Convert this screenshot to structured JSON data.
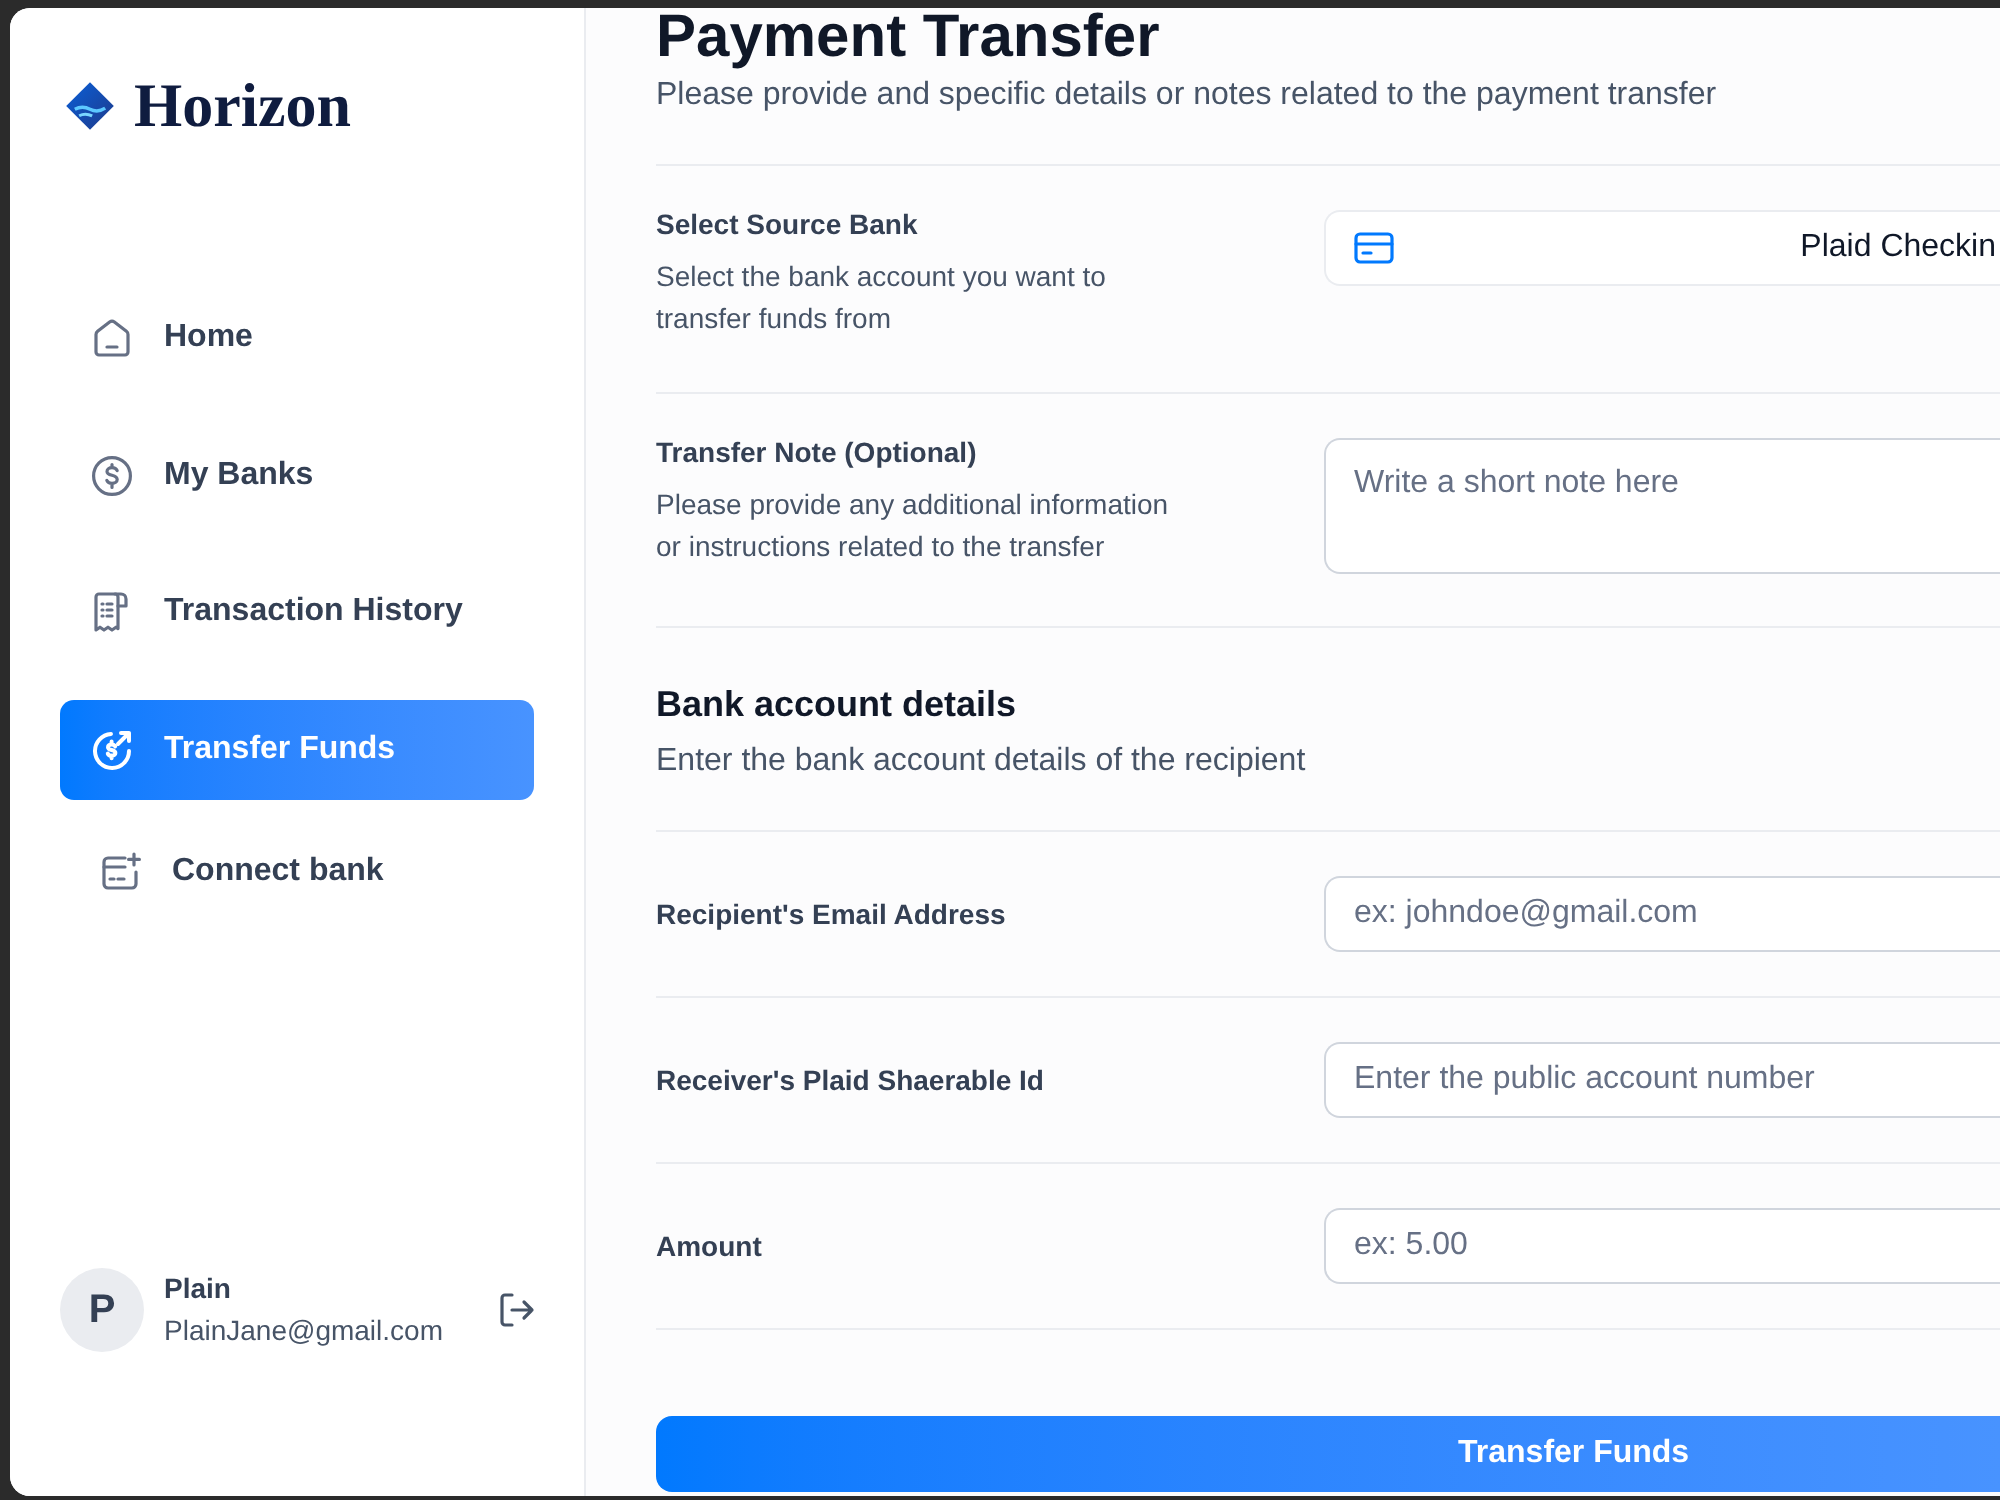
{
  "sidebar": {
    "logo": {
      "name": "Horizon"
    },
    "nav_items": [
      {
        "label": "Home",
        "kind": "nav",
        "selected": false
      },
      {
        "label": "My Banks",
        "kind": "nav",
        "selected": false
      },
      {
        "label": "Transaction History",
        "kind": "nav",
        "selected": false
      },
      {
        "label": "Transfer Funds",
        "kind": "nav",
        "selected": true
      },
      {
        "label": "Connect bank",
        "kind": "action",
        "selected": false
      }
    ],
    "user": {
      "initial": "P",
      "name": "Plain",
      "email": "PlainJane@gmail.com"
    }
  },
  "header": {
    "title": "Payment Transfer",
    "subtitle": "Please provide and specific details or notes related to the payment transfer"
  },
  "transfer_details": [
    {
      "kind": "select",
      "label": "Select Source Bank",
      "description": "Select the bank account you want to transfer funds from",
      "value": "Plaid Checkin"
    },
    {
      "kind": "textarea",
      "label": "Transfer Note (Optional)",
      "description": "Please provide any additional information or instructions related to the transfer",
      "placeholder": "Write a short note here"
    }
  ],
  "bank_account_details": {
    "title": "Bank account details",
    "subtitle": "Enter the bank account details of the recipient",
    "fields": [
      {
        "label": "Recipient's Email Address",
        "placeholder": "ex: johndoe@gmail.com"
      },
      {
        "label": "Receiver's Plaid Shaerable Id",
        "placeholder": "Enter the public account number"
      },
      {
        "label": "Amount",
        "placeholder": "ex: 5.00"
      }
    ]
  },
  "submit_button": {
    "label": "Transfer Funds"
  }
}
